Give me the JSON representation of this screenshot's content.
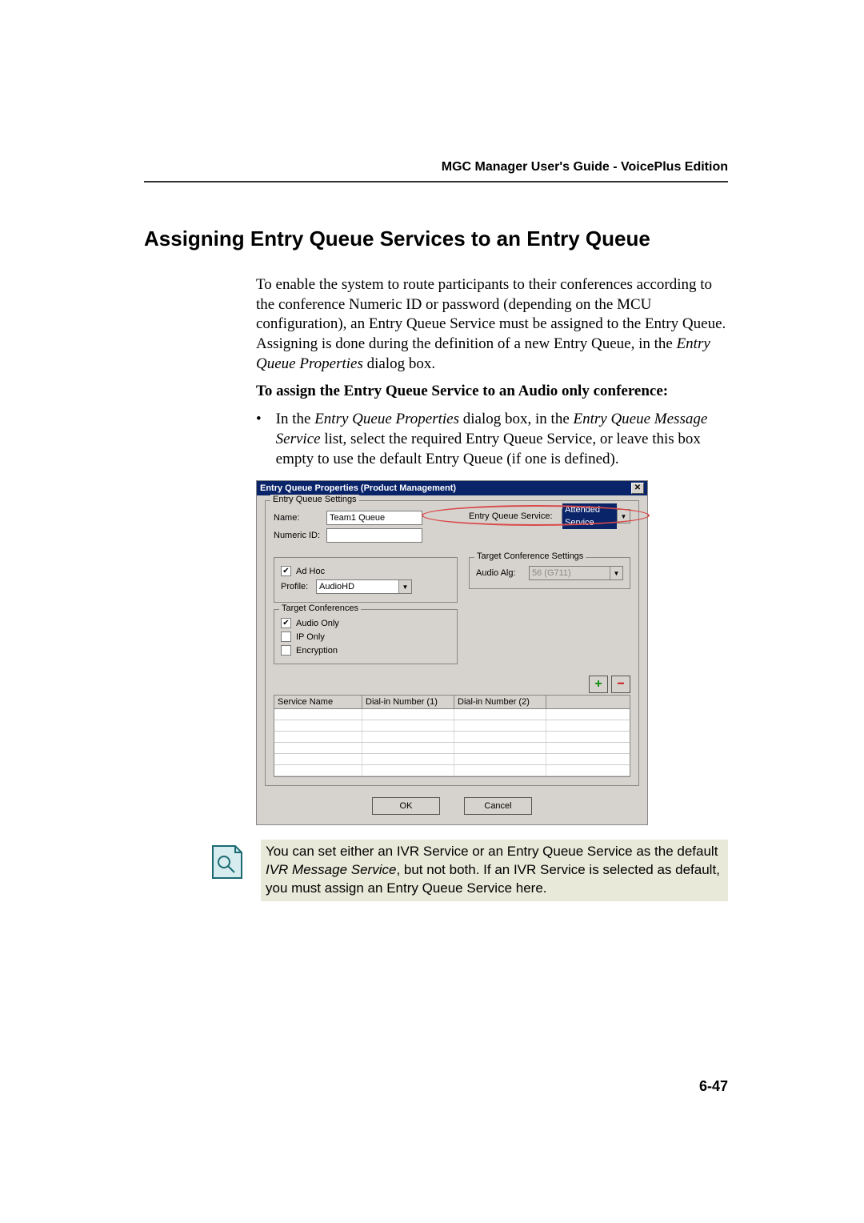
{
  "header": {
    "guide_title": "MGC Manager User's Guide - VoicePlus Edition"
  },
  "section": {
    "title": "Assigning Entry Queue Services to an Entry Queue"
  },
  "intro": {
    "pre": "To enable the system to route participants to their conferences according to the conference Numeric ID or password (depending on the MCU configuration), an Entry Queue Service must be assigned to the Entry Queue. Assigning is done during the definition of a new Entry Queue, in the ",
    "em": "Entry Queue Properties",
    "post": " dialog box."
  },
  "task": {
    "heading": "To assign the Entry Queue Service to an Audio only conference:"
  },
  "bullet": {
    "pre": "In the ",
    "em1": "Entry Queue Properties",
    "mid1": " dialog box, in the ",
    "em2": "Entry Queue Message Service",
    "post": " list, select the required Entry Queue Service, or leave this box empty to use the default Entry Queue (if one is defined)."
  },
  "dialog": {
    "title": "Entry Queue Properties (Product Management)",
    "settings_legend": "Entry Queue Settings",
    "name_label": "Name:",
    "name_value": "Team1 Queue",
    "numeric_label": "Numeric ID:",
    "numeric_value": "",
    "eqs_label": "Entry Queue Service:",
    "eqs_value": "Attended Service",
    "adhoc_label": "Ad Hoc",
    "profile_label": "Profile:",
    "profile_value": "AudioHD",
    "tcs_legend": "Target Conference Settings",
    "audio_alg_label": "Audio Alg:",
    "audio_alg_value": "56 (G711)",
    "tc_legend": "Target Conferences",
    "audio_only_label": "Audio Only",
    "ip_only_label": "IP Only",
    "encryption_label": "Encryption",
    "grid": {
      "col1": "Service Name",
      "col2": "Dial-in Number (1)",
      "col3": "Dial-in Number (2)",
      "col4": ""
    },
    "ok": "OK",
    "cancel": "Cancel"
  },
  "note": {
    "pre": "You can set either an IVR Service or an Entry Queue Service as the default ",
    "em": "IVR Message Service",
    "post": ", but not both. If an IVR Service is selected as default, you must assign an Entry Queue Service here."
  },
  "page_number": "6-47",
  "chart_data": null
}
